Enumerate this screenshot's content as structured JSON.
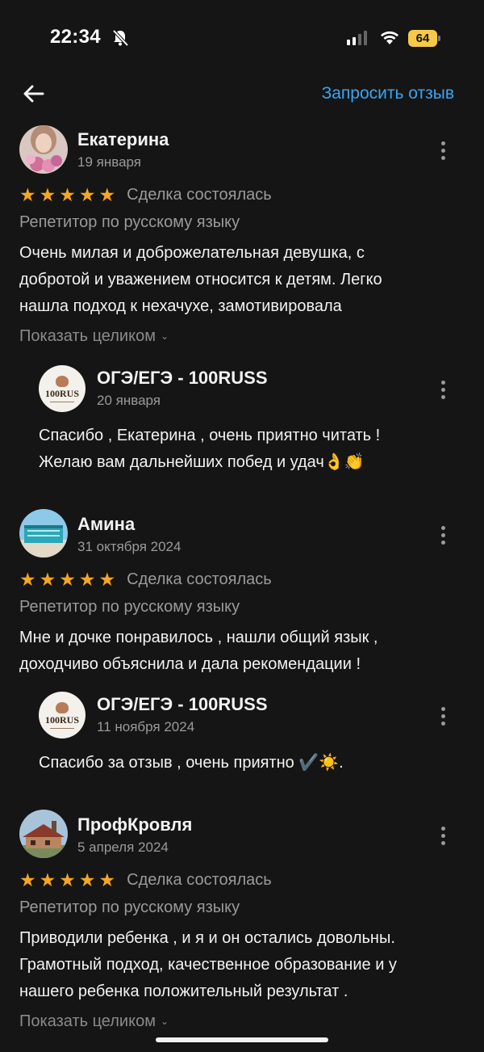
{
  "status_bar": {
    "time": "22:34",
    "battery": "64"
  },
  "header": {
    "request_review": "Запросить отзыв"
  },
  "colors": {
    "accent": "#3aa5f3",
    "star": "#f5a623",
    "battery": "#f7c948",
    "background": "#151515"
  },
  "reviews": [
    {
      "author": "Екатерина",
      "date": "19 января",
      "rating": 5,
      "deal_status": "Сделка состоялась",
      "category": "Репетитор по русскому языку",
      "text_lines": [
        "Очень милая и доброжелательная девушка, с",
        "добротой и уважением относится к детям. Легко",
        "нашла подход к нехачухе, замотивировала"
      ],
      "show_full": "Показать целиком",
      "reply": {
        "author": "ОГЭ/ЕГЭ - 100RUSS",
        "logo_text": "100RUS",
        "date": "20 января",
        "text_lines": [
          "Спасибо , Екатерина , очень приятно читать !",
          "Желаю вам дальнейших побед и удач👌👏"
        ]
      }
    },
    {
      "author": "Амина",
      "date": "31 октября 2024",
      "rating": 5,
      "deal_status": "Сделка состоялась",
      "category": "Репетитор по русскому языку",
      "text_lines": [
        "Мне и дочке понравилось , нашли общий язык ,",
        "доходчиво объяснила и дала рекомендации !"
      ],
      "reply": {
        "author": "ОГЭ/ЕГЭ - 100RUSS",
        "logo_text": "100RUS",
        "date": "11 ноября 2024",
        "text_lines": [
          "Спасибо за отзыв , очень приятно ✔️☀️."
        ]
      }
    },
    {
      "author": "ПрофКровля",
      "date": "5 апреля 2024",
      "rating": 5,
      "deal_status": "Сделка состоялась",
      "category": "Репетитор по русскому языку",
      "text_lines": [
        "Приводили ребенка , и я и он остались довольны.",
        "Грамотный подход, качественное образование и у",
        "нашего ребенка положительный результат ."
      ],
      "show_full": "Показать целиком"
    }
  ]
}
